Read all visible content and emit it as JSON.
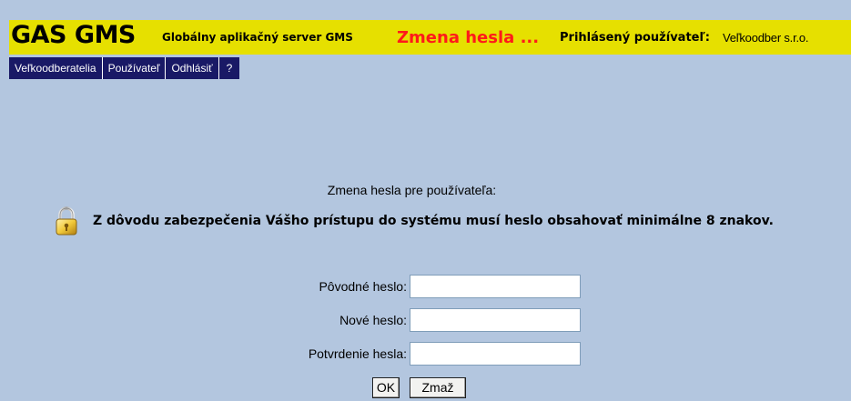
{
  "header": {
    "brand": "GAS GMS",
    "brand_subtitle": "Globálny aplikačný server GMS",
    "page_heading": "Zmena hesla ...",
    "user_label": "Prihlásený používateľ:",
    "user_value": "Veľkoodber s.r.o.",
    "background_color": "#e6e000",
    "heading_color": "#ff1a1a"
  },
  "nav": {
    "items": [
      {
        "label": "Veľkoodberatelia"
      },
      {
        "label": "Používateľ"
      },
      {
        "label": "Odhlásiť"
      },
      {
        "label": "?"
      }
    ],
    "background_color": "#191966"
  },
  "main": {
    "section_title": "Zmena hesla pre používateľa:",
    "notice_icon": "lock-icon",
    "notice_text": "Z dôvodu zabezpečenia Vášho prístupu do systému musí heslo obsahovať minimálne 8 znakov."
  },
  "form": {
    "fields": [
      {
        "label": "Pôvodné heslo:",
        "value": ""
      },
      {
        "label": "Nové heslo:",
        "value": ""
      },
      {
        "label": "Potvrdenie hesla:",
        "value": ""
      }
    ],
    "ok_label": "OK",
    "clear_label": "Zmaž"
  },
  "page_background": "#b3c6df"
}
